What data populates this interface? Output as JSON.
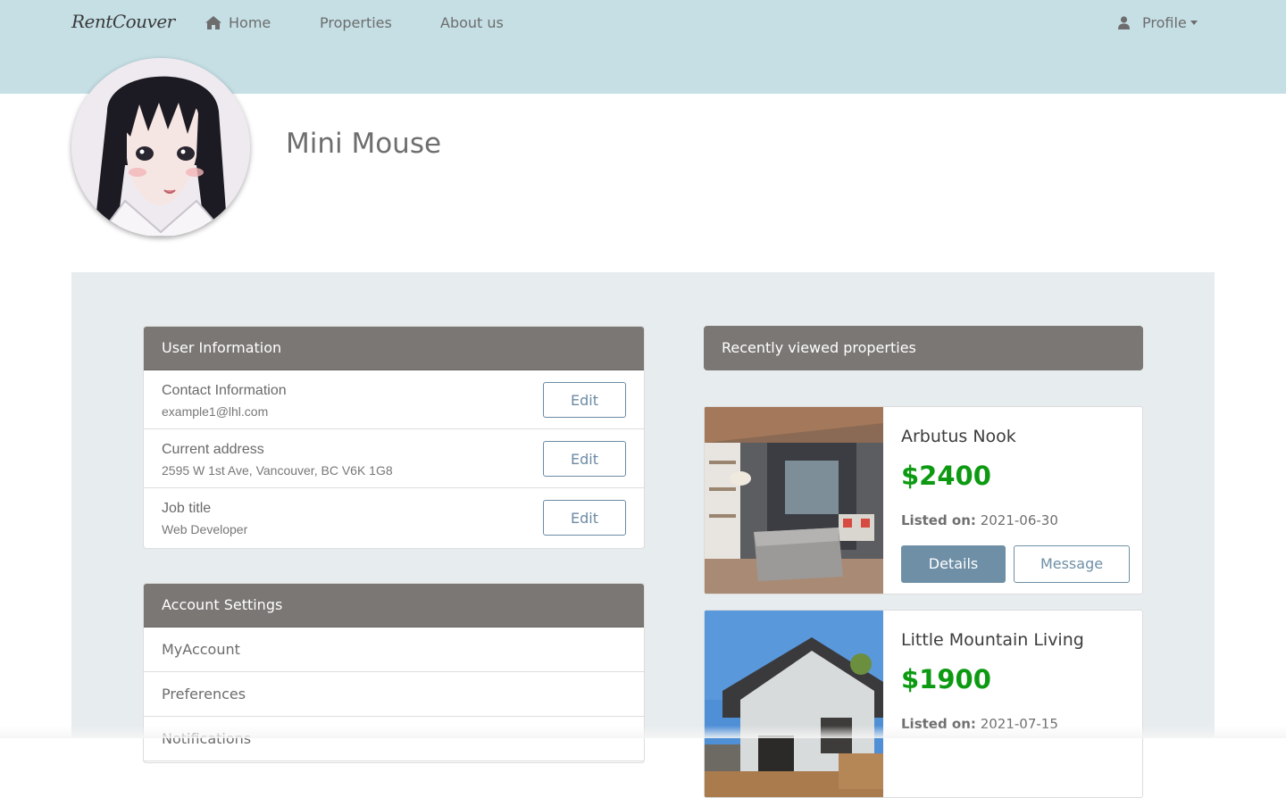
{
  "nav": {
    "brand": "RentCouver",
    "home": "Home",
    "properties": "Properties",
    "about": "About us",
    "profile": "Profile"
  },
  "profile": {
    "name": "Mini Mouse"
  },
  "user_info": {
    "header": "User Information",
    "rows": [
      {
        "label": "Contact Information",
        "value": "example1@lhl.com",
        "action": "Edit"
      },
      {
        "label": "Current address",
        "value": "2595 W 1st Ave, Vancouver, BC V6K 1G8",
        "action": "Edit"
      },
      {
        "label": "Job title",
        "value": "Web Developer",
        "action": "Edit"
      }
    ]
  },
  "account_settings": {
    "header": "Account Settings",
    "items": [
      "MyAccount",
      "Preferences",
      "Notifications"
    ]
  },
  "recent": {
    "header": "Recently viewed properties",
    "listed_label": "Listed on:",
    "details_label": "Details",
    "message_label": "Message",
    "properties": [
      {
        "title": "Arbutus Nook",
        "price": "$2400",
        "listed": "2021-06-30"
      },
      {
        "title": "Little Mountain Living",
        "price": "$1900",
        "listed": "2021-07-15"
      }
    ]
  },
  "colors": {
    "navbar": "#c5dfe5",
    "card_header": "#7a7775",
    "price": "#0d9a12",
    "accent": "#6e8fa6"
  }
}
